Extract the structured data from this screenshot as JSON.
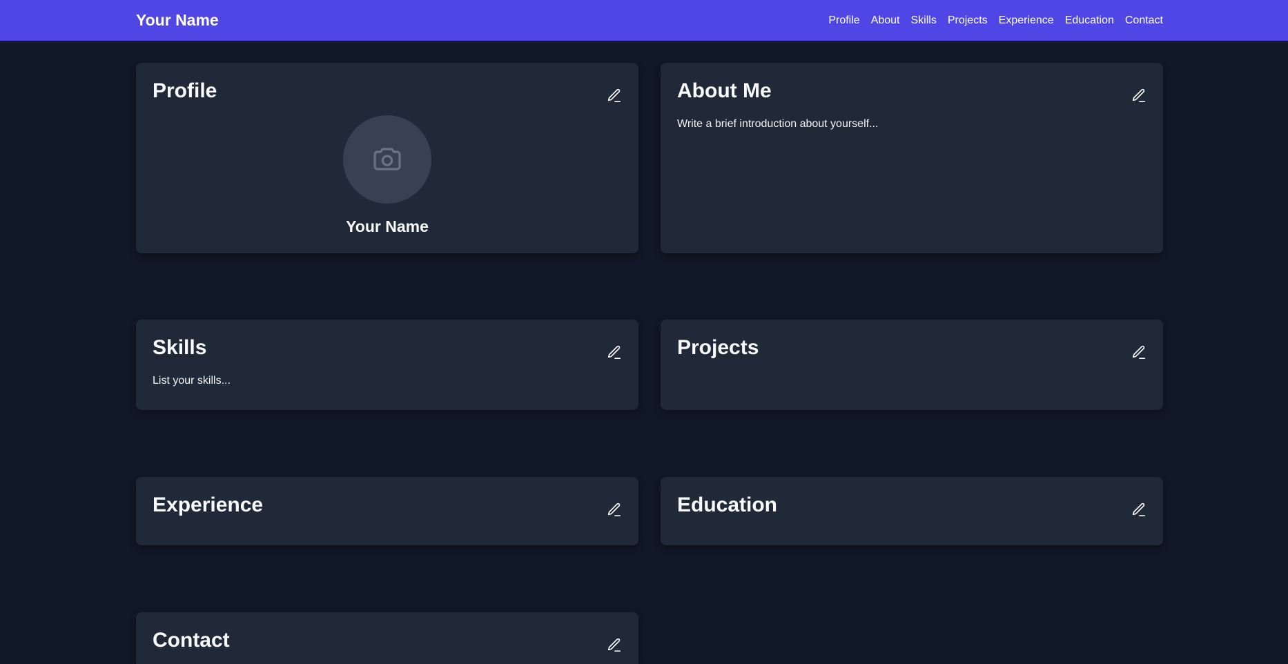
{
  "header": {
    "brand": "Your Name",
    "nav": [
      "Profile",
      "About",
      "Skills",
      "Projects",
      "Experience",
      "Education",
      "Contact"
    ]
  },
  "profile": {
    "title": "Profile",
    "name": "Your Name"
  },
  "about": {
    "title": "About Me",
    "text": "Write a brief introduction about yourself..."
  },
  "skills": {
    "title": "Skills",
    "text": "List your skills..."
  },
  "projects": {
    "title": "Projects"
  },
  "experience": {
    "title": "Experience"
  },
  "education": {
    "title": "Education"
  },
  "contact": {
    "title": "Contact"
  },
  "colors": {
    "accent": "#4f46e5",
    "background": "#111827",
    "card": "#1f2937",
    "avatar": "#374151"
  },
  "icons": {
    "edit": "pencil-icon",
    "avatar": "camera-icon"
  }
}
